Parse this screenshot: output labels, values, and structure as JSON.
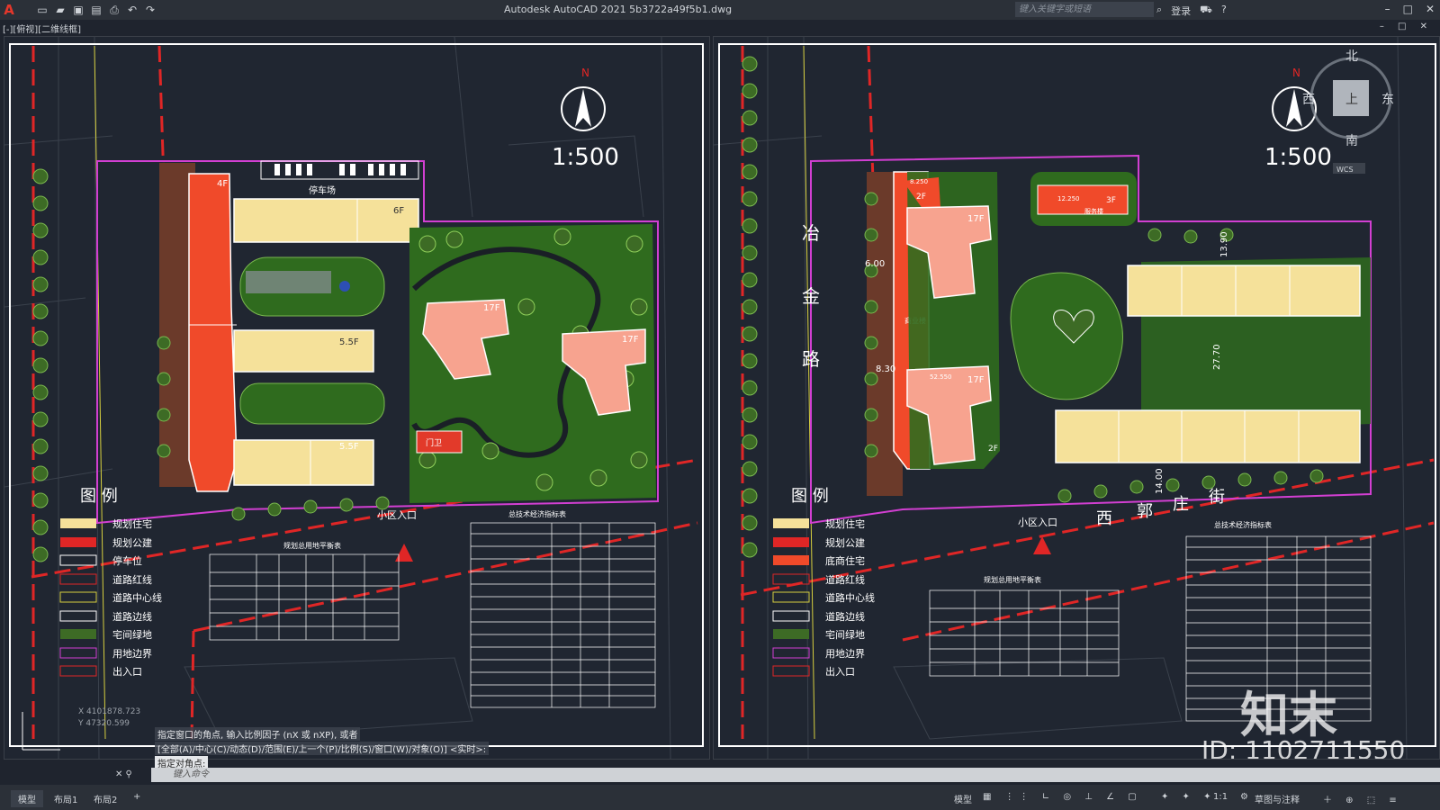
{
  "app": {
    "logo": "A",
    "title": "Autodesk AutoCAD 2021    5b3722a49f5b1.dwg",
    "search_placeholder": "键入关键字或短语",
    "login_label": "登录",
    "view_label": "[-][俯视][二维线框]"
  },
  "quick_access": [
    "new-icon",
    "open-icon",
    "save-icon",
    "saveas-icon",
    "plot-icon",
    "undo-icon",
    "redo-icon"
  ],
  "left_plan": {
    "north": "N",
    "scale": "1:500",
    "labels": {
      "parking": "停车场",
      "entrance": "小区入口",
      "gate": "门卫"
    },
    "floors": [
      "4F",
      "6F",
      "5.5F",
      "5.5F",
      "17F",
      "17F"
    ],
    "legend_title": "图  例",
    "legend": [
      "规划住宅",
      "规划公建",
      "停车位",
      "道路红线",
      "道路中心线",
      "道路边线",
      "宅间绿地",
      "用地边界",
      "出入口"
    ],
    "table_left_title": "规划总用地平衡表",
    "table_right_title": "总技术经济指标表",
    "coords": [
      "X 4101878.723",
      "Y 47320.599"
    ]
  },
  "right_plan": {
    "north": "N",
    "scale": "1:500",
    "road_vertical": [
      "冶",
      "金",
      "路"
    ],
    "road_horizontal": [
      "西",
      "郭",
      "庄",
      "街"
    ],
    "labels": {
      "entrance": "小区入口",
      "commercial": "商业楼",
      "service": "服务楼"
    },
    "floors": [
      "2F",
      "17F",
      "17F",
      "2F",
      "3F"
    ],
    "dims": [
      "6.00",
      "8.30",
      "13.90",
      "27.70",
      "14.00"
    ],
    "elevations": [
      "8.250",
      "12.250",
      "52.550",
      "52.550"
    ],
    "legend_title": "图  例",
    "legend": [
      "规划住宅",
      "规划公建",
      "底商住宅",
      "道路红线",
      "道路中心线",
      "道路边线",
      "宅间绿地",
      "用地边界",
      "出入口"
    ],
    "table_left_title": "规划总用地平衡表",
    "table_right_title": "总技术经济指标表",
    "viewcube": {
      "n": "北",
      "s": "南",
      "e": "东",
      "w": "西",
      "face": "上",
      "wcs": "WCS"
    }
  },
  "command": {
    "history1": "指定窗口的角点, 输入比例因子 (nX 或 nXP), 或者",
    "history2": "[全部(A)/中心(C)/动态(D)/范围(E)/上一个(P)/比例(S)/窗口(W)/对象(O)] <实时>:",
    "history3": "指定对角点:",
    "placeholder": "键入命令"
  },
  "tabs": [
    "模型",
    "布局1",
    "布局2",
    "+"
  ],
  "status": {
    "model": "模型",
    "scale": "1:1",
    "workspace": "草图与注释"
  },
  "watermark": {
    "brand": "知末",
    "id": "ID: 1102711550"
  }
}
